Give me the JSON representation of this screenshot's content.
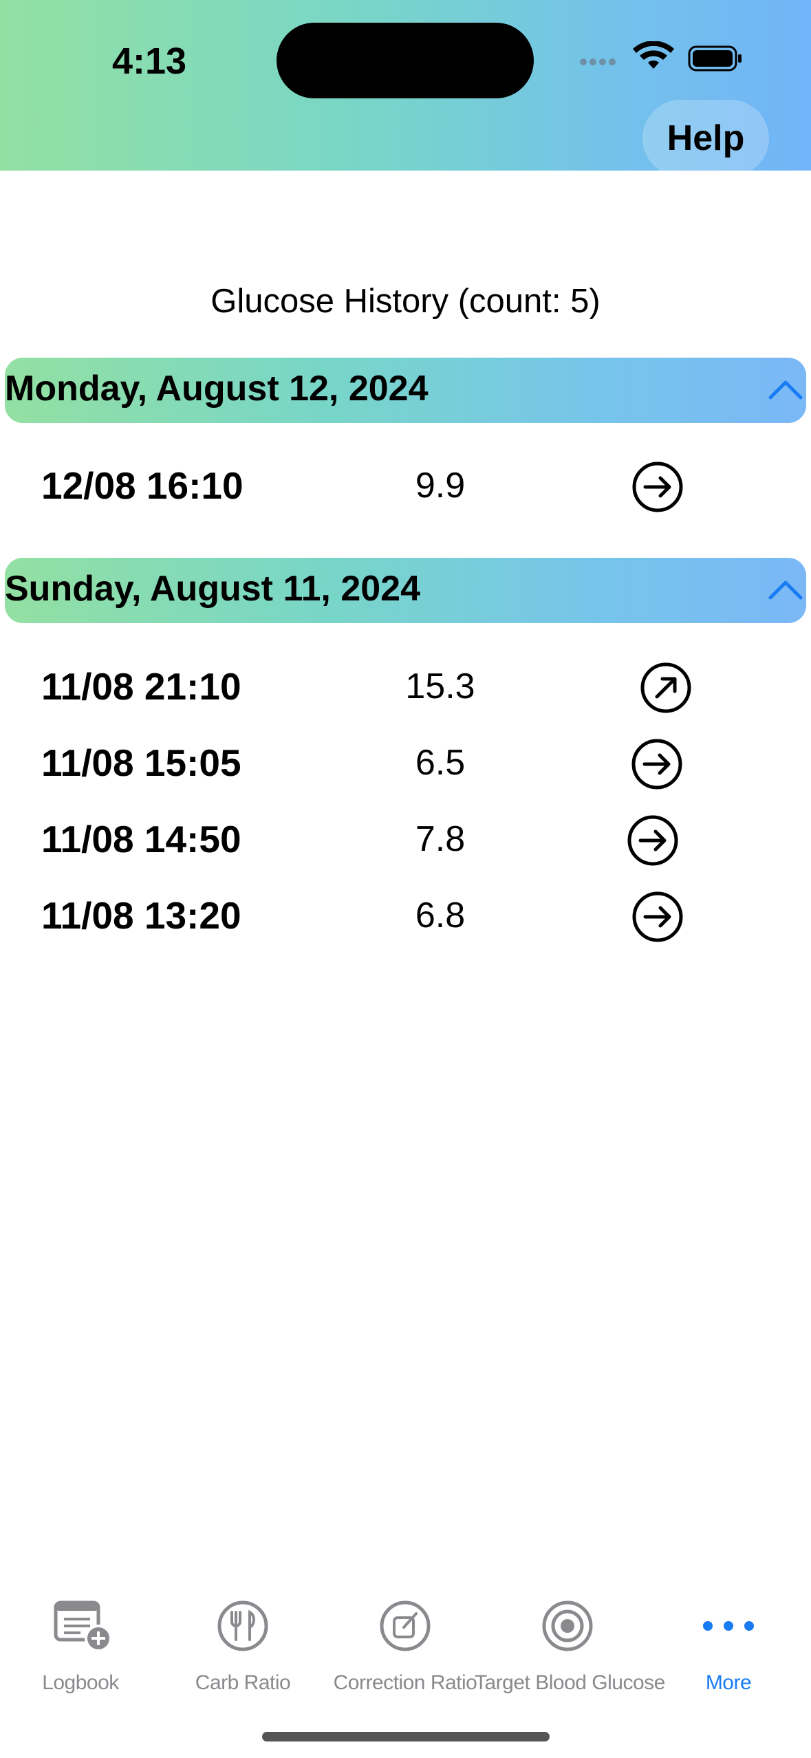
{
  "status_bar": {
    "time": "4:13"
  },
  "header": {
    "help_label": "Help"
  },
  "history": {
    "title": "Glucose History (count: 5)",
    "sections": [
      {
        "title": "Monday, August 12, 2024",
        "rows": [
          {
            "time": "12/08 16:10",
            "value": "9.9",
            "trend_icon": "arrow-right-circle-icon"
          }
        ]
      },
      {
        "title": "Sunday, August 11, 2024",
        "rows": [
          {
            "time": "11/08 21:10",
            "value": "15.3",
            "trend_icon": "arrow-up-right-circle-icon"
          },
          {
            "time": "11/08 15:05",
            "value": "6.5",
            "trend_icon": "arrow-right-circle-icon"
          },
          {
            "time": "11/08 14:50",
            "value": "7.8",
            "trend_icon": "arrow-right-circle-icon"
          },
          {
            "time": "11/08 13:20",
            "value": "6.8",
            "trend_icon": "arrow-right-circle-icon"
          }
        ]
      }
    ]
  },
  "tabbar": {
    "tabs": [
      {
        "label": "Logbook",
        "icon": "logbook-add-icon",
        "active": false
      },
      {
        "label": "Carb Ratio",
        "icon": "fork-knife-icon",
        "active": false
      },
      {
        "label": "Correction Ratio",
        "icon": "edit-square-icon",
        "active": false
      },
      {
        "label": "Target Blood Glucose",
        "icon": "target-icon",
        "active": false
      },
      {
        "label": "More",
        "icon": "more-dots-icon",
        "active": true
      }
    ]
  },
  "colors": {
    "accent": "#1a7cf5",
    "gradient_start": "#93e0a2",
    "gradient_end": "#72b4f8",
    "inactive_tab": "#8a8a8e"
  }
}
